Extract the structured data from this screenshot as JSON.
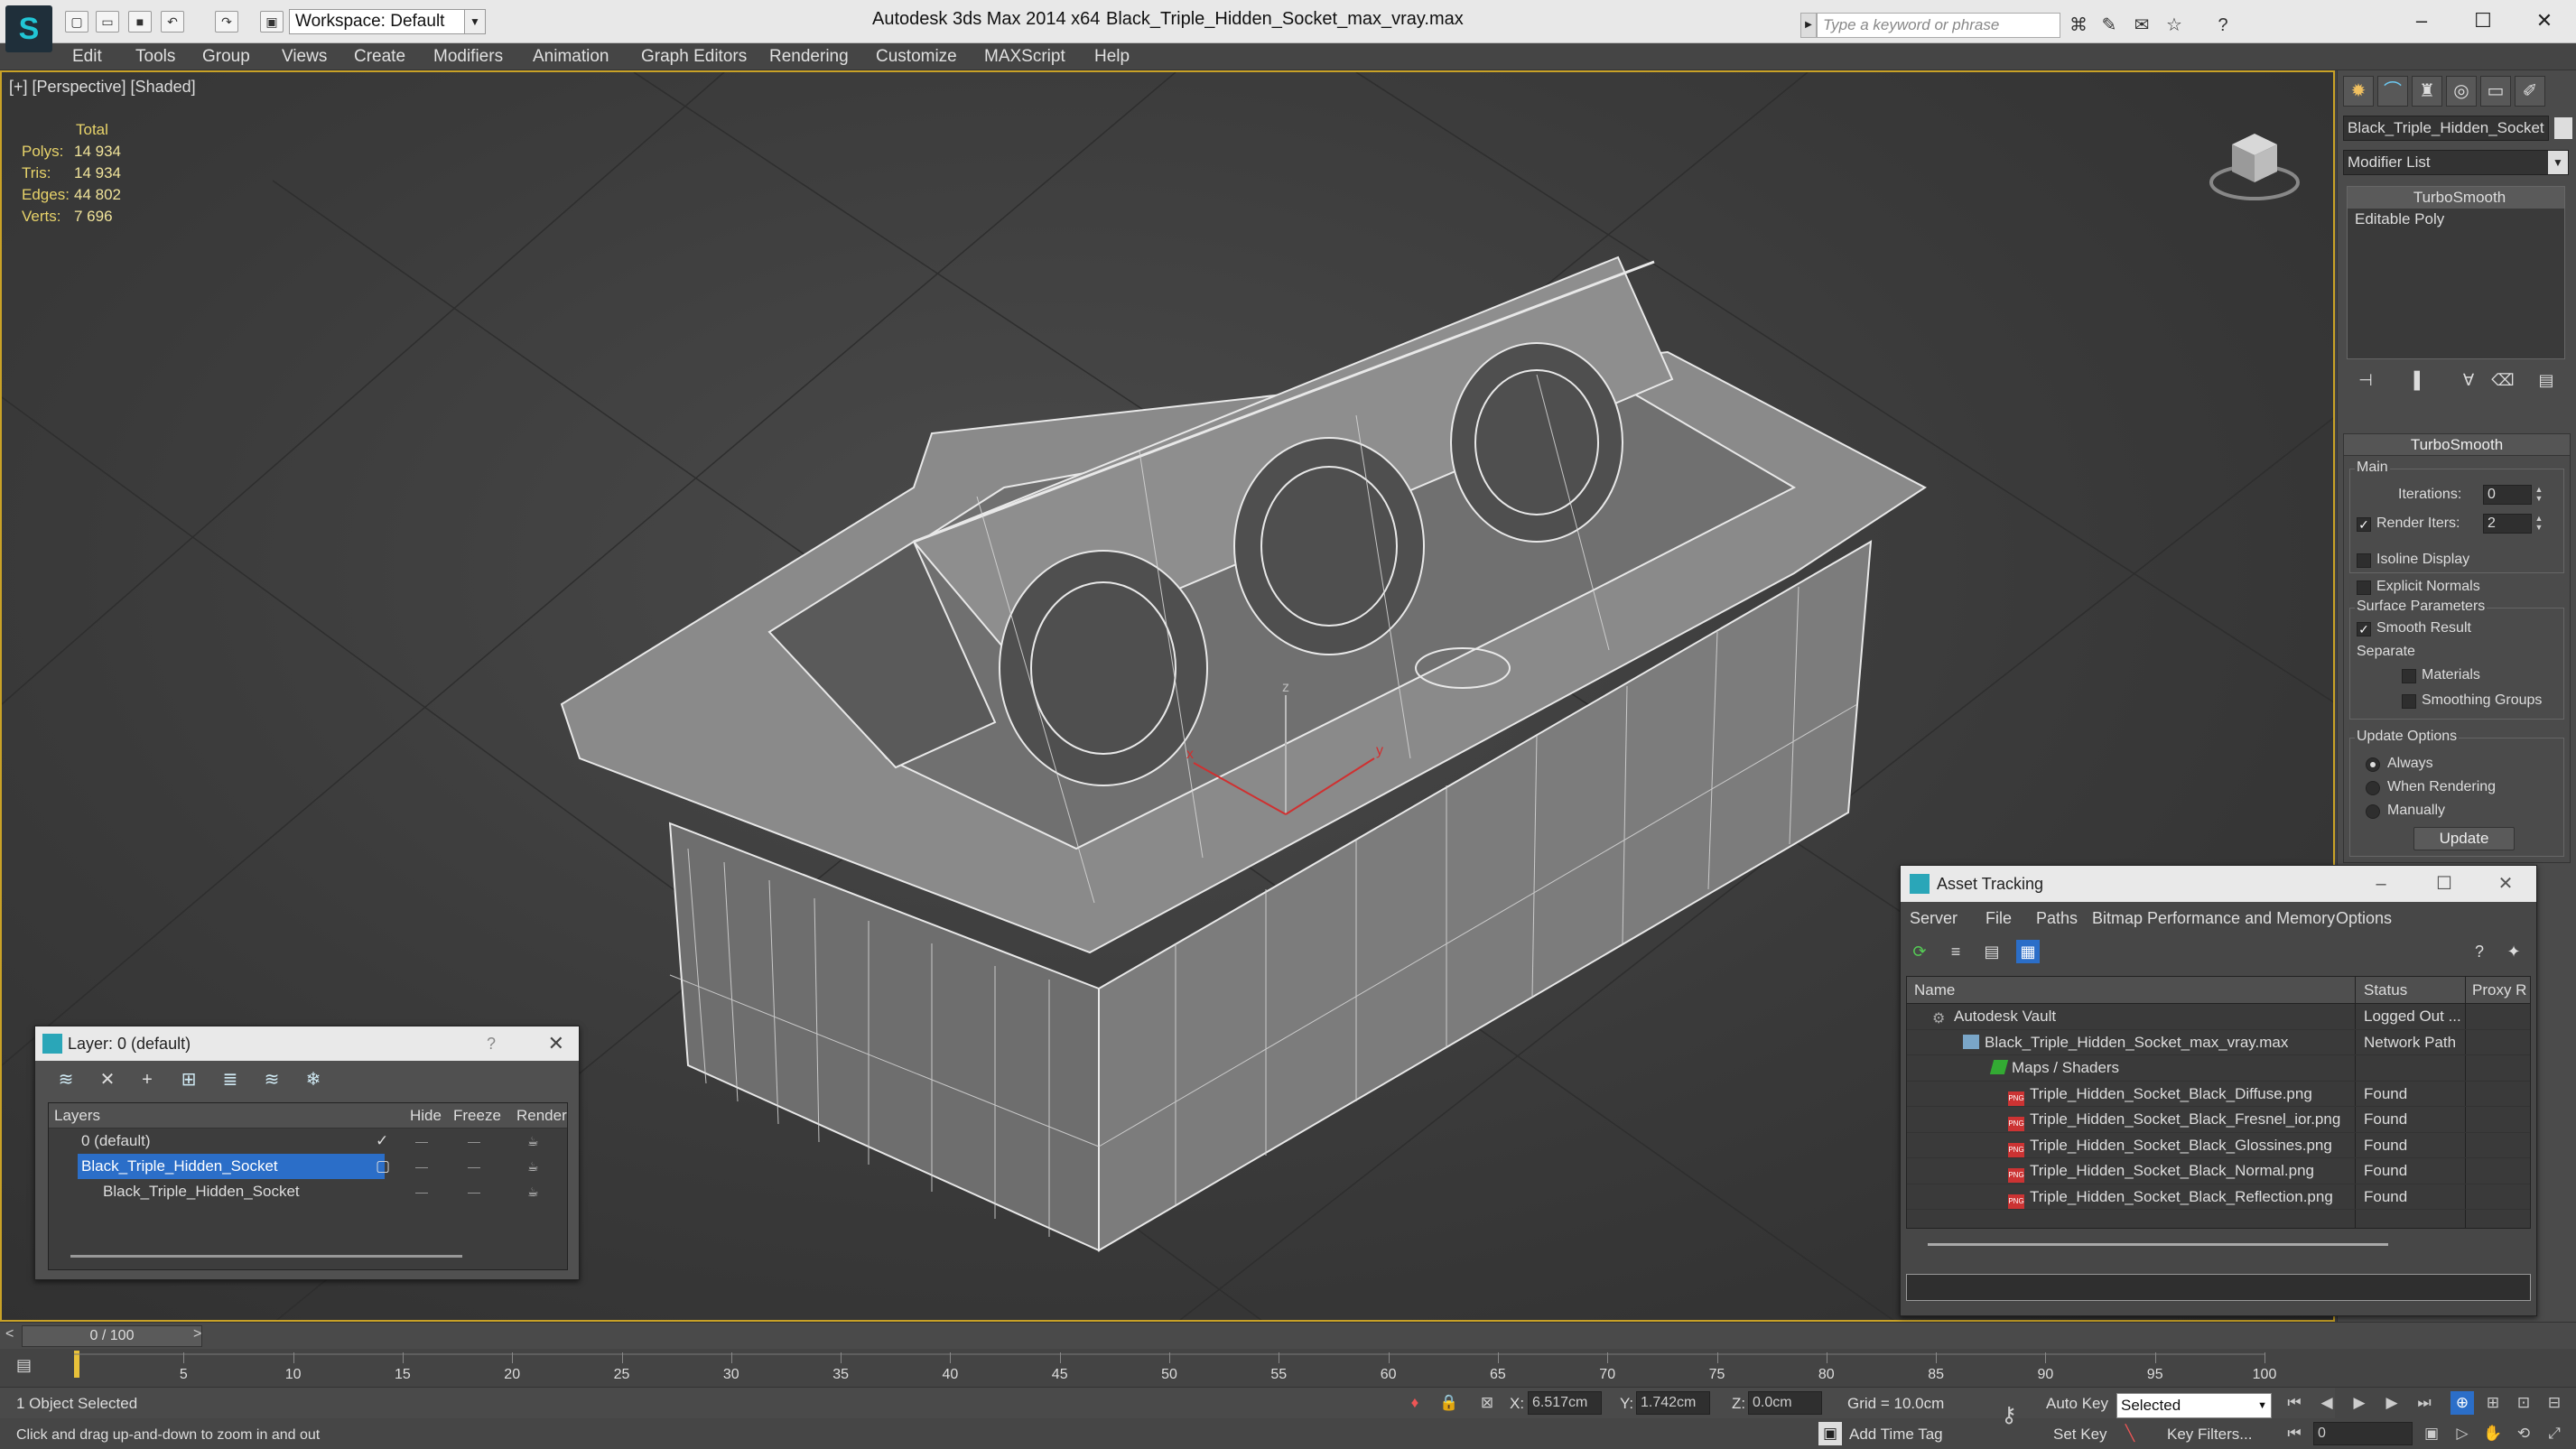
{
  "titlebar": {
    "workspace": "Workspace: Default",
    "app_title": "Autodesk 3ds Max  2014 x64",
    "file_title": "Black_Triple_Hidden_Socket_max_vray.max",
    "search_placeholder": "Type a keyword or phrase"
  },
  "menu": [
    "Edit",
    "Tools",
    "Group",
    "Views",
    "Create",
    "Modifiers",
    "Animation",
    "Graph Editors",
    "Rendering",
    "Customize",
    "MAXScript",
    "Help"
  ],
  "viewport": {
    "label": "[+] [Perspective] [Shaded]",
    "stats": {
      "header": "Total",
      "rows": [
        {
          "label": "Polys:",
          "value": "14 934"
        },
        {
          "label": "Tris:",
          "value": "14 934"
        },
        {
          "label": "Edges:",
          "value": "44 802"
        },
        {
          "label": "Verts:",
          "value": "7 696"
        }
      ]
    },
    "axis_x": "x",
    "axis_y": "y",
    "axis_z": "z"
  },
  "command_panel": {
    "object_name": "Black_Triple_Hidden_Socket",
    "modifier_list": "Modifier List",
    "stack": [
      "TurboSmooth",
      "Editable Poly"
    ],
    "rollout_title": "TurboSmooth",
    "main_label": "Main",
    "iterations_label": "Iterations:",
    "iterations_value": "0",
    "render_iters_label": "Render Iters:",
    "render_iters_value": "2",
    "isoline_label": "Isoline Display",
    "explicit_normals_label": "Explicit Normals",
    "surface_params_label": "Surface Parameters",
    "smooth_result_label": "Smooth Result",
    "separate_label": "Separate",
    "materials_label": "Materials",
    "smoothing_groups_label": "Smoothing Groups",
    "update_options_label": "Update Options",
    "always_label": "Always",
    "when_rendering_label": "When Rendering",
    "manually_label": "Manually",
    "update_button": "Update"
  },
  "layer_dialog": {
    "title": "Layer: 0 (default)",
    "help": "?",
    "columns": {
      "layers": "Layers",
      "hide": "Hide",
      "freeze": "Freeze",
      "render": "Render"
    },
    "rows": [
      {
        "name": "0 (default)"
      },
      {
        "name": "Black_Triple_Hidden_Socket"
      },
      {
        "name": "Black_Triple_Hidden_Socket"
      }
    ]
  },
  "asset_dialog": {
    "title": "Asset Tracking",
    "menu": [
      "Server",
      "File",
      "Paths",
      "Bitmap Performance and Memory",
      "Options"
    ],
    "columns": {
      "name": "Name",
      "status": "Status",
      "proxy": "Proxy R"
    },
    "rows": [
      {
        "name": "Autodesk Vault",
        "status": "Logged Out ..."
      },
      {
        "name": "Black_Triple_Hidden_Socket_max_vray.max",
        "status": "Network Path"
      },
      {
        "name": "Maps / Shaders",
        "status": ""
      },
      {
        "name": "Triple_Hidden_Socket_Black_Diffuse.png",
        "status": "Found"
      },
      {
        "name": "Triple_Hidden_Socket_Black_Fresnel_ior.png",
        "status": "Found"
      },
      {
        "name": "Triple_Hidden_Socket_Black_Glossines.png",
        "status": "Found"
      },
      {
        "name": "Triple_Hidden_Socket_Black_Normal.png",
        "status": "Found"
      },
      {
        "name": "Triple_Hidden_Socket_Black_Reflection.png",
        "status": "Found"
      }
    ]
  },
  "timeline": {
    "slider": "0 / 100",
    "ticks": [
      "5",
      "10",
      "15",
      "20",
      "25",
      "30",
      "35",
      "40",
      "45",
      "50",
      "55",
      "60",
      "65",
      "70",
      "75",
      "80",
      "85",
      "90",
      "95",
      "100"
    ]
  },
  "status": {
    "selection": "1 Object Selected",
    "prompt": "Click and drag up-and-down to zoom in and out",
    "x_label": "X:",
    "x_value": "6.517cm",
    "y_label": "Y:",
    "y_value": "1.742cm",
    "z_label": "Z:",
    "z_value": "0.0cm",
    "grid": "Grid = 10.0cm",
    "add_time_tag": "Add Time Tag",
    "auto_key": "Auto Key",
    "set_key": "Set Key",
    "selected": "Selected",
    "key_filters": "Key Filters...",
    "frame": "0"
  }
}
